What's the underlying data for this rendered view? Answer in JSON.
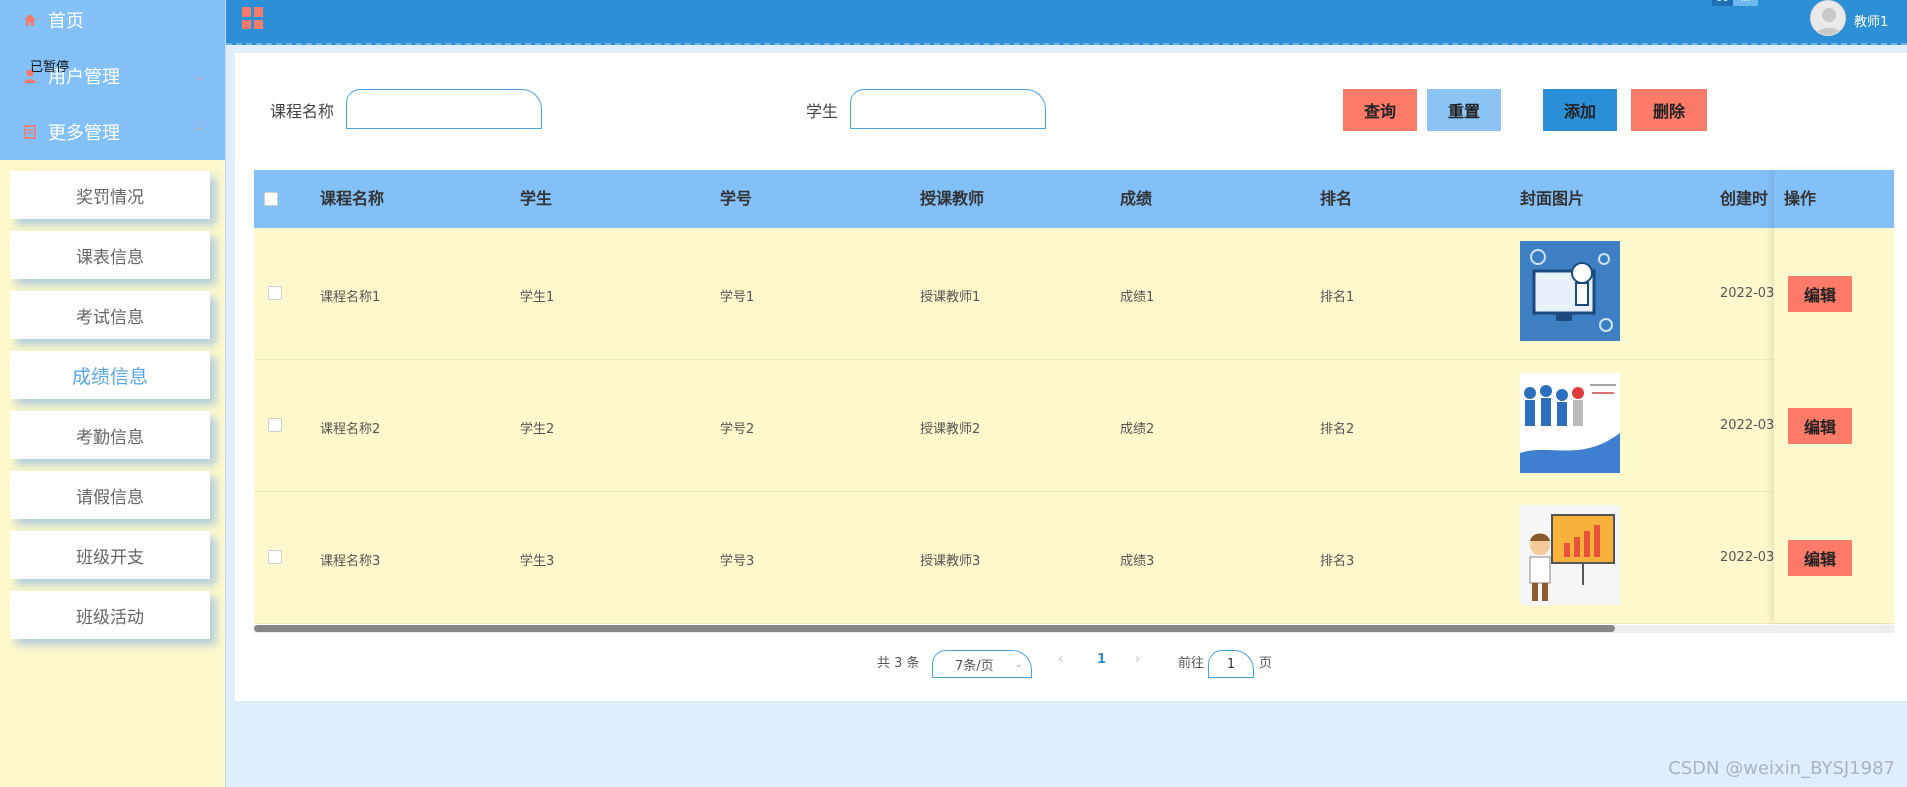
{
  "sidebar": {
    "home": "首页",
    "user_mgmt": "用户管理",
    "more_mgmt": "更多管理",
    "paused_overlay": "已暂停",
    "items": [
      "奖罚情况",
      "课表信息",
      "考试信息",
      "成绩信息",
      "考勤信息",
      "请假信息",
      "班级开支",
      "班级活动"
    ],
    "active_index": 3
  },
  "header": {
    "badge_left": "00",
    "badge_right": "...",
    "username": "教师1"
  },
  "search": {
    "course_label": "课程名称",
    "student_label": "学生",
    "course_value": "",
    "student_value": ""
  },
  "buttons": {
    "query": "查询",
    "reset": "重置",
    "add": "添加",
    "delete": "删除"
  },
  "table": {
    "columns": [
      "课程名称",
      "学生",
      "学号",
      "授课教师",
      "成绩",
      "排名",
      "封面图片",
      "创建时",
      "操作"
    ],
    "rows": [
      {
        "course": "课程名称1",
        "student": "学生1",
        "sid": "学号1",
        "teacher": "授课教师1",
        "score": "成绩1",
        "rank": "排名1",
        "created": "2022-03-",
        "edit": "编辑"
      },
      {
        "course": "课程名称2",
        "student": "学生2",
        "sid": "学号2",
        "teacher": "授课教师2",
        "score": "成绩2",
        "rank": "排名2",
        "created": "2022-03-",
        "edit": "编辑"
      },
      {
        "course": "课程名称3",
        "student": "学生3",
        "sid": "学号3",
        "teacher": "授课教师3",
        "score": "成绩3",
        "rank": "排名3",
        "created": "2022-03-",
        "edit": "编辑"
      }
    ],
    "scroll_fraction": 0.83
  },
  "pagination": {
    "total": "共 3 条",
    "page_size": "7条/页",
    "current_page": "1",
    "goto_label": "前往",
    "goto_value": "1",
    "page_suffix": "页"
  },
  "watermark": "CSDN @weixin_BYSJ1987",
  "colors": {
    "sidebar_top": "#84c0f8",
    "header": "#2d8fd6",
    "row_bg": "#fdf9cc",
    "danger": "#fb7b68",
    "primary": "#2a8fd6"
  }
}
